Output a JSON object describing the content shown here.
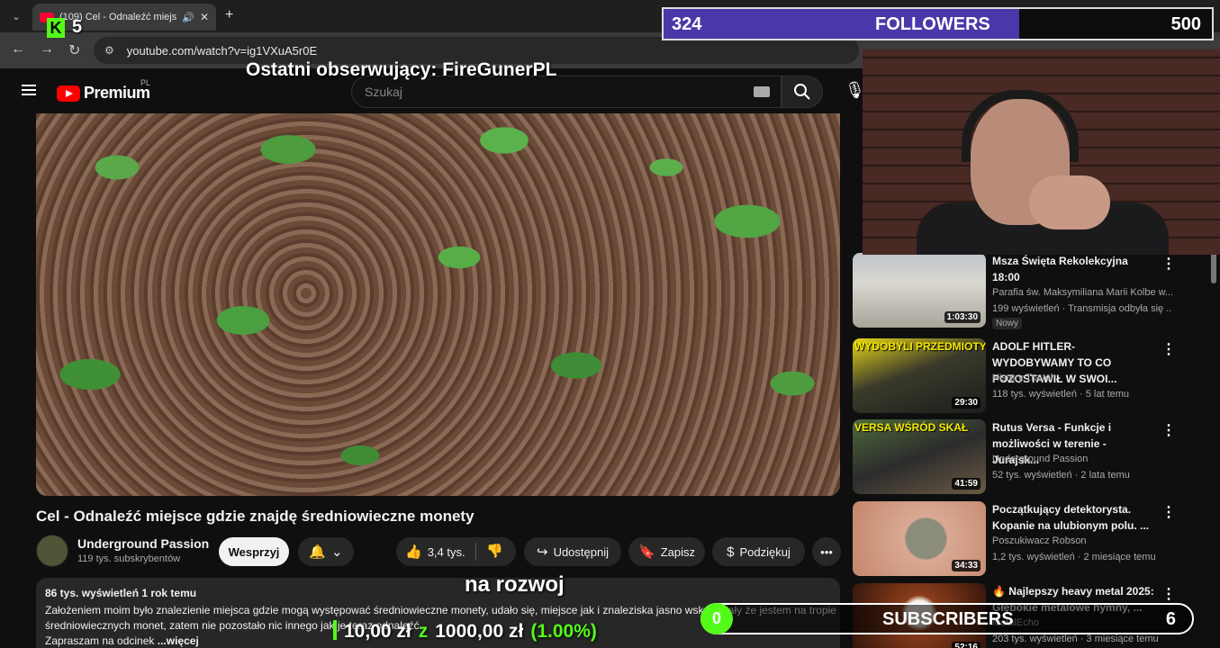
{
  "browser": {
    "tab_title": "(109) Cel - Odnaleźć miejsc",
    "url": "youtube.com/watch?v=ig1VXuA5r0E"
  },
  "youtube": {
    "logo_text": "Premium",
    "country_code": "PL",
    "search_placeholder": "Szukaj"
  },
  "video": {
    "title": "Cel - Odnaleźć miejsce gdzie znajdę średniowieczne monety",
    "channel_name": "Underground Passion",
    "channel_subs": "119 tys. subskrybentów",
    "support_label": "Wesprzyj",
    "likes": "3,4 tys.",
    "share_label": "Udostępnij",
    "save_label": "Zapisz",
    "thanks_label": "Podziękuj",
    "views_meta": "86 tys. wyświetleń  1 rok temu",
    "description": "Założeniem moim było znalezienie miejsca gdzie mogą występować średniowieczne monety, udało się, miejsce jak i znaleziska jasno wskazywały że jestem na tropie średniowiecznych monet, zatem nie pozostało nic innego jak je teraz odnaleźć.",
    "description_line3": "Zapraszam na odcinek",
    "more_label": "...więcej"
  },
  "recommendations": [
    {
      "title": "Msza Święta Rekolekcyjna 18:00",
      "channel": "Parafia św. Maksymiliana Marii Kolbe w...",
      "stats": "199 wyświetleń · Transmisja odbyła się ...",
      "duration": "1:03:30",
      "badge": "Nowy",
      "thumb_text": ""
    },
    {
      "title": "ADOLF HITLER-WYDOBYWAMY TO CO POZOSTAWIŁ W SWOI...",
      "channel": "History Travel",
      "stats": "118 tys. wyświetleń · 5 lat temu",
      "duration": "29:30",
      "badge": "",
      "thumb_text": "WYDOBYLI PRZEDMIOTY"
    },
    {
      "title": "Rutus Versa - Funkcje i możliwości w terenie - Jurajsk...",
      "channel": "Underground Passion",
      "stats": "52 tys. wyświetleń · 2 lata temu",
      "duration": "41:59",
      "badge": "",
      "thumb_text": "VERSA WŚRÓD SKAŁ"
    },
    {
      "title": "Początkujący detektorysta. Kopanie na ulubionym polu. ...",
      "channel": "Poszukiwacz Robson",
      "stats": "1,2 tys. wyświetleń · 2 miesiące temu",
      "duration": "34:33",
      "badge": "",
      "thumb_text": ""
    },
    {
      "title": "🔥 Najlepszy heavy metal 2025: Głębokie metalowe hymny, ...",
      "channel": "MetalEcho",
      "stats": "203 tys. wyświetleń · 3 miesiące temu",
      "duration": "52:16",
      "badge": "",
      "thumb_text": ""
    }
  ],
  "overlay": {
    "kick_count": "5",
    "last_follower": "Ostatni obserwujący: FireGunerPL",
    "followers_current": "324",
    "followers_label": "FOLLOWERS",
    "followers_goal": "500",
    "followers_progress": 0.648,
    "donation_label": "na rozwoj",
    "donation_current": "10,00 zł",
    "donation_sep": "z",
    "donation_goal": "1000,00 zł",
    "donation_percent": "(1.00%)",
    "subs_current": "0",
    "subs_label": "SUBSCRIBERS",
    "subs_goal": "6"
  },
  "colors": {
    "kick_green": "#53fc18",
    "followers_fill": "#4b37a8",
    "yt_red": "#ff0000"
  }
}
